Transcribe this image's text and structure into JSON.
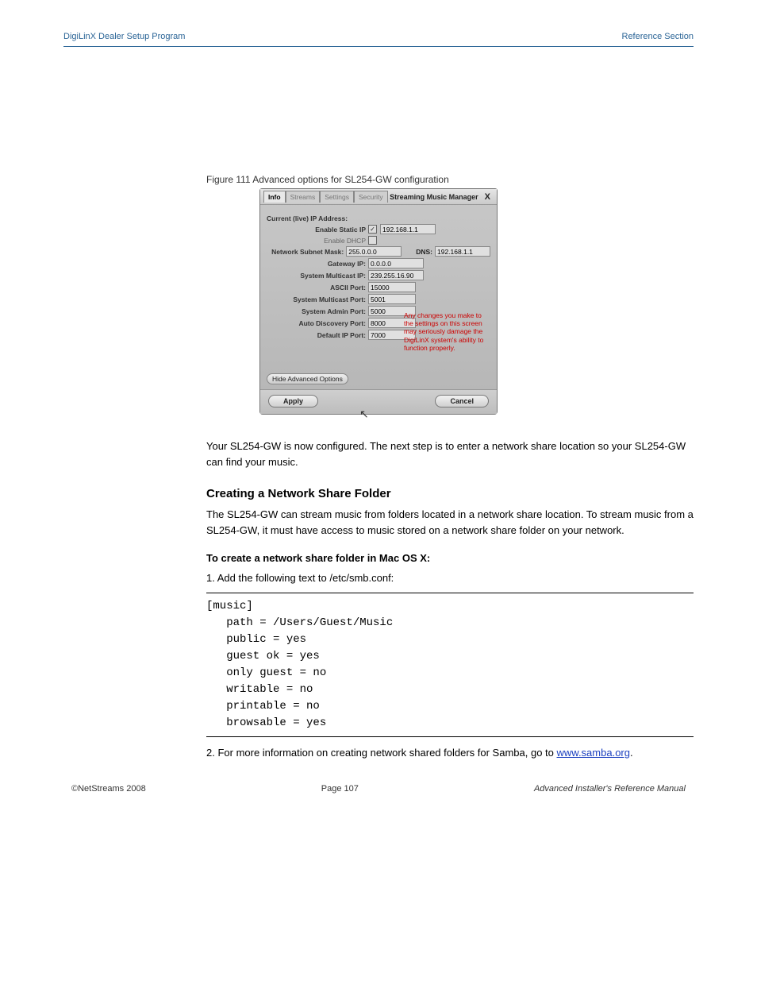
{
  "header": {
    "left": "DigiLinX Dealer Setup Program",
    "right": "Reference Section"
  },
  "caption": "Figure 111 Advanced options for SL254-GW configuration",
  "dialog": {
    "tabs": [
      "Info",
      "Streams",
      "Settings",
      "Security"
    ],
    "active_tab": "Info",
    "title": "Streaming Music Manager",
    "close": "X",
    "rows": {
      "current_ip_lbl": "Current (live) IP Address:",
      "enable_static_lbl": "Enable Static IP",
      "static_ip": "192.168.1.1",
      "enable_dhcp_lbl": "Enable DHCP",
      "subnet_lbl": "Network Subnet Mask:",
      "subnet": "255.0.0.0",
      "dns_lbl": "DNS:",
      "dns": "192.168.1.1",
      "gateway_lbl": "Gateway IP:",
      "gateway": "0.0.0.0",
      "multicast_ip_lbl": "System Multicast IP:",
      "multicast_ip": "239.255.16.90",
      "ascii_lbl": "ASCII Port:",
      "ascii": "15000",
      "multicast_port_lbl": "System Multicast Port:",
      "multicast_port": "5001",
      "admin_lbl": "System Admin Port:",
      "admin": "5000",
      "autodisc_lbl": "Auto Discovery Port:",
      "autodisc": "8000",
      "default_ip_port_lbl": "Default IP Port:",
      "default_ip_port": "7000"
    },
    "warning": "Any changes you make to the settings on this screen may seriously damage the DigiLinX system's ability to function properly.",
    "hide_adv": "Hide Advanced Options",
    "apply": "Apply",
    "cancel": "Cancel"
  },
  "body": {
    "p1": "Your SL254-GW is now configured. The next step is to enter a network share location so your SL254-GW can find your music.",
    "h1": "Creating a Network Share Folder",
    "p2": "The SL254-GW can stream music from folders located in a network share location. To stream music from a SL254-GW, it must have access to music stored on a network share folder on your network.",
    "sh1": "To create a network share folder in Mac OS X:",
    "step1": "1. Add the following text to /etc/smb.conf:",
    "code": "[music]\n   path = /Users/Guest/Music\n   public = yes\n   guest ok = yes\n   only guest = no\n   writable = no\n   printable = no\n   browsable = yes",
    "step2_a": "2. For more information on creating network shared folders for Samba, go to ",
    "step2_link": "www.samba.org",
    "step2_b": "."
  },
  "footer": {
    "copyright": "©NetStreams 2008",
    "page_left": "Page",
    "page_num": "107",
    "manual": "Advanced Installer's Reference Manual"
  }
}
